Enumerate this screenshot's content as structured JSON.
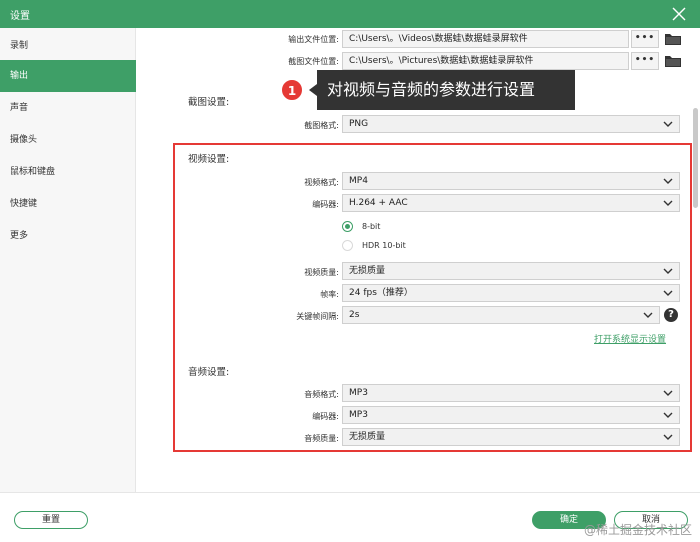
{
  "window": {
    "title": "设置"
  },
  "sidebar": {
    "items": [
      {
        "label": "录制",
        "active": false
      },
      {
        "label": "输出",
        "active": true
      },
      {
        "label": "声音",
        "active": false
      },
      {
        "label": "摄像头",
        "active": false
      },
      {
        "label": "鼠标和键盘",
        "active": false
      },
      {
        "label": "快捷键",
        "active": false
      },
      {
        "label": "更多",
        "active": false
      }
    ]
  },
  "output": {
    "output_path_label": "输出文件位置:",
    "output_path_value": "C:\\Users\\。\\Videos\\数据蛙\\数据蛙录屏软件",
    "screenshot_path_label": "截图文件位置:",
    "screenshot_path_value": "C:\\Users\\。\\Pictures\\数据蛙\\数据蛙录屏软件",
    "browse_label": "•••"
  },
  "screenshot_settings": {
    "title": "截图设置:",
    "format_label": "截图格式:",
    "format_value": "PNG"
  },
  "video_settings": {
    "title": "视频设置:",
    "format_label": "视频格式:",
    "format_value": "MP4",
    "encoder_label": "编码器:",
    "encoder_value": "H.264 + AAC",
    "bit_option_1": "8-bit",
    "bit_option_2": "HDR 10-bit",
    "quality_label": "视频质量:",
    "quality_value": "无损质量",
    "framerate_label": "帧率:",
    "framerate_value": "24 fps（推荐）",
    "keyframe_label": "关键帧间隔:",
    "keyframe_value": "2s",
    "help_glyph": "?",
    "display_settings_link": "打开系统显示设置"
  },
  "audio_settings": {
    "title": "音频设置:",
    "format_label": "音频格式:",
    "format_value": "MP3",
    "encoder_label": "编码器:",
    "encoder_value": "MP3",
    "quality_label": "音频质量:",
    "quality_value": "无损质量"
  },
  "annotation": {
    "badge": "1",
    "text": "对视频与音频的参数进行设置"
  },
  "footer": {
    "reset_label": "重置",
    "confirm_label": "确定",
    "cancel_label": "取消"
  },
  "watermark": "@稀土掘金技术社区",
  "colors": {
    "accent": "#3e9f67",
    "highlight": "#e53935",
    "tooltip_bg": "#333333"
  }
}
